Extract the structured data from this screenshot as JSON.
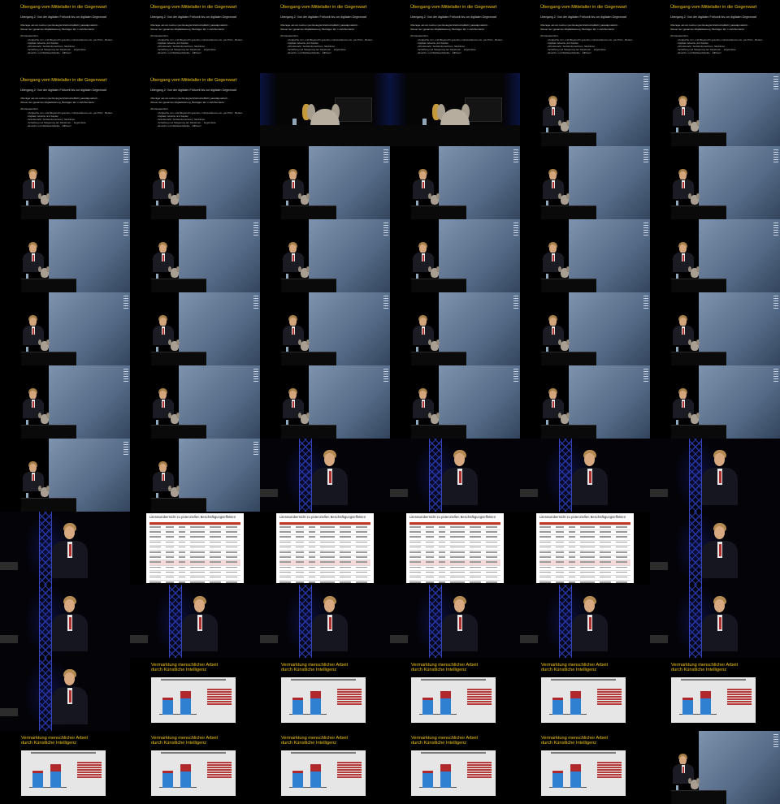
{
  "slides": {
    "intro": {
      "title": "Übergang vom Mittelalter in die Gegenwart",
      "subtitle": "Übergang 2: Von der digitalen Frühzeit bis zur digitalen Gegenwart",
      "bullets": [
        "Weniger als ein rechen (technologisch/wirtschaftlich) paradigmatisch...",
        "Neuer der gesamten Digitalisierung, Beträgen als 'x-Jahrhunderte'"
      ],
      "group_label": "Konsequenzen",
      "sub_bullets": [
        "Vergleiche von- und Biogerecht gesehen. Interpretationen ein- per-Prinz - Besten-",
        "Digitale Industrie und Kapital",
        "Arbeitsmarkt, Sozialunternehmen, Strukturen",
        "Schaffung und Steigerung der Strukturen ... Ergebnisse",
        "Einsicht- und Weltbeschränkte... Effizienz"
      ]
    },
    "table": {
      "title": "Literaturübersicht zu potenziellen Beschäftigungseffekten"
    },
    "chart": {
      "title_line1": "Vermarktung menschlicher Arbeit",
      "title_line2": "durch Künstliche Intelligenz"
    }
  },
  "grid": {
    "columns": 6,
    "rows": 11,
    "cells": [
      "slide-intro",
      "slide-intro",
      "slide-intro",
      "slide-intro",
      "slide-intro",
      "slide-intro",
      "slide-intro",
      "slide-intro",
      "scene-plush",
      "scene-plush",
      "scene-screen",
      "scene-screen",
      "scene-screen",
      "scene-screen",
      "scene-screen",
      "scene-screen",
      "scene-screen",
      "scene-screen",
      "scene-screen",
      "scene-screen",
      "scene-screen",
      "scene-screen",
      "scene-screen",
      "scene-screen",
      "scene-screen",
      "scene-screen",
      "scene-screen",
      "scene-screen",
      "scene-screen",
      "scene-screen",
      "scene-screen",
      "scene-screen",
      "scene-screen",
      "scene-screen",
      "scene-screen",
      "scene-screen",
      "scene-screen",
      "scene-screen",
      "scene-truss",
      "scene-truss",
      "scene-truss",
      "scene-truss",
      "scene-truss",
      "slide-table",
      "slide-table",
      "slide-table",
      "slide-table",
      "scene-truss",
      "scene-truss",
      "scene-truss",
      "scene-truss",
      "scene-truss",
      "scene-truss",
      "scene-truss",
      "scene-truss",
      "slide-chart",
      "slide-chart",
      "slide-chart",
      "slide-chart",
      "slide-chart",
      "slide-chart",
      "slide-chart",
      "slide-chart",
      "slide-chart",
      "slide-chart",
      "scene-screen"
    ]
  },
  "colors": {
    "slide_title": "#f1c40f",
    "table_accent": "#c0392b",
    "bar_blue": "#2f80d0",
    "bar_red": "#b0282b",
    "truss_blue": "#2a3bb5",
    "screen_blue": "#6a7f9b"
  }
}
